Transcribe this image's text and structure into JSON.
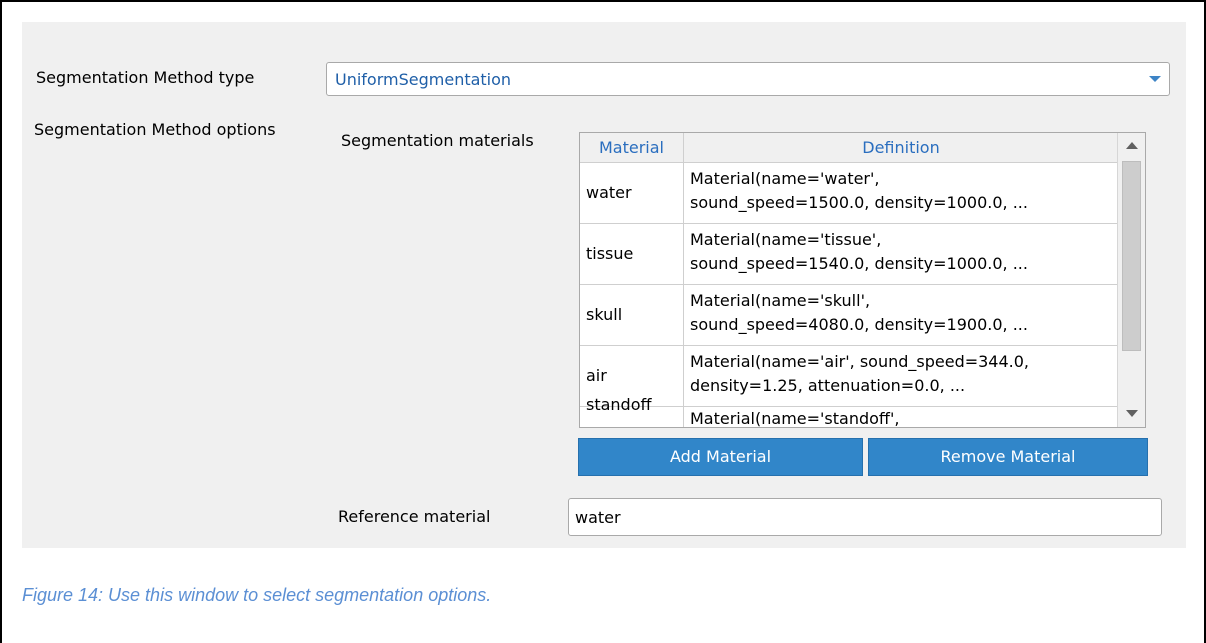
{
  "segmentation_method_type": {
    "label": "Segmentation Method type",
    "value": "UniformSegmentation"
  },
  "segmentation_method_options": {
    "label": "Segmentation Method options"
  },
  "segmentation_materials": {
    "label": "Segmentation materials",
    "columns": [
      "Material",
      "Definition"
    ],
    "rows": [
      {
        "material": "water",
        "definition_line1": "Material(name='water',",
        "definition_line2": "sound_speed=1500.0, density=1000.0, ..."
      },
      {
        "material": "tissue",
        "definition_line1": "Material(name='tissue',",
        "definition_line2": "sound_speed=1540.0, density=1000.0, ..."
      },
      {
        "material": "skull",
        "definition_line1": "Material(name='skull',",
        "definition_line2": "sound_speed=4080.0, density=1900.0, ..."
      },
      {
        "material": "air",
        "definition_line1": "Material(name='air', sound_speed=344.0,",
        "definition_line2": "density=1.25, attenuation=0.0, ..."
      },
      {
        "material": "standoff",
        "definition_line1": "Material(name='standoff',",
        "definition_line2": ""
      }
    ]
  },
  "buttons": {
    "add_label": "Add Material",
    "remove_label": "Remove Material"
  },
  "reference_material": {
    "label": "Reference material",
    "value": "water"
  },
  "caption": "Figure 14: Use this window to select segmentation options.",
  "colors": {
    "panel_bg": "#f0f0f0",
    "accent": "#3186c9",
    "header_text": "#2a6ebf",
    "combo_text": "#1f5fa8",
    "caption_text": "#5b8fd4"
  },
  "icons": {
    "combo_dropdown": "chevron-down-icon",
    "scroll_up": "scroll-up-arrow-icon",
    "scroll_down": "scroll-down-arrow-icon"
  }
}
